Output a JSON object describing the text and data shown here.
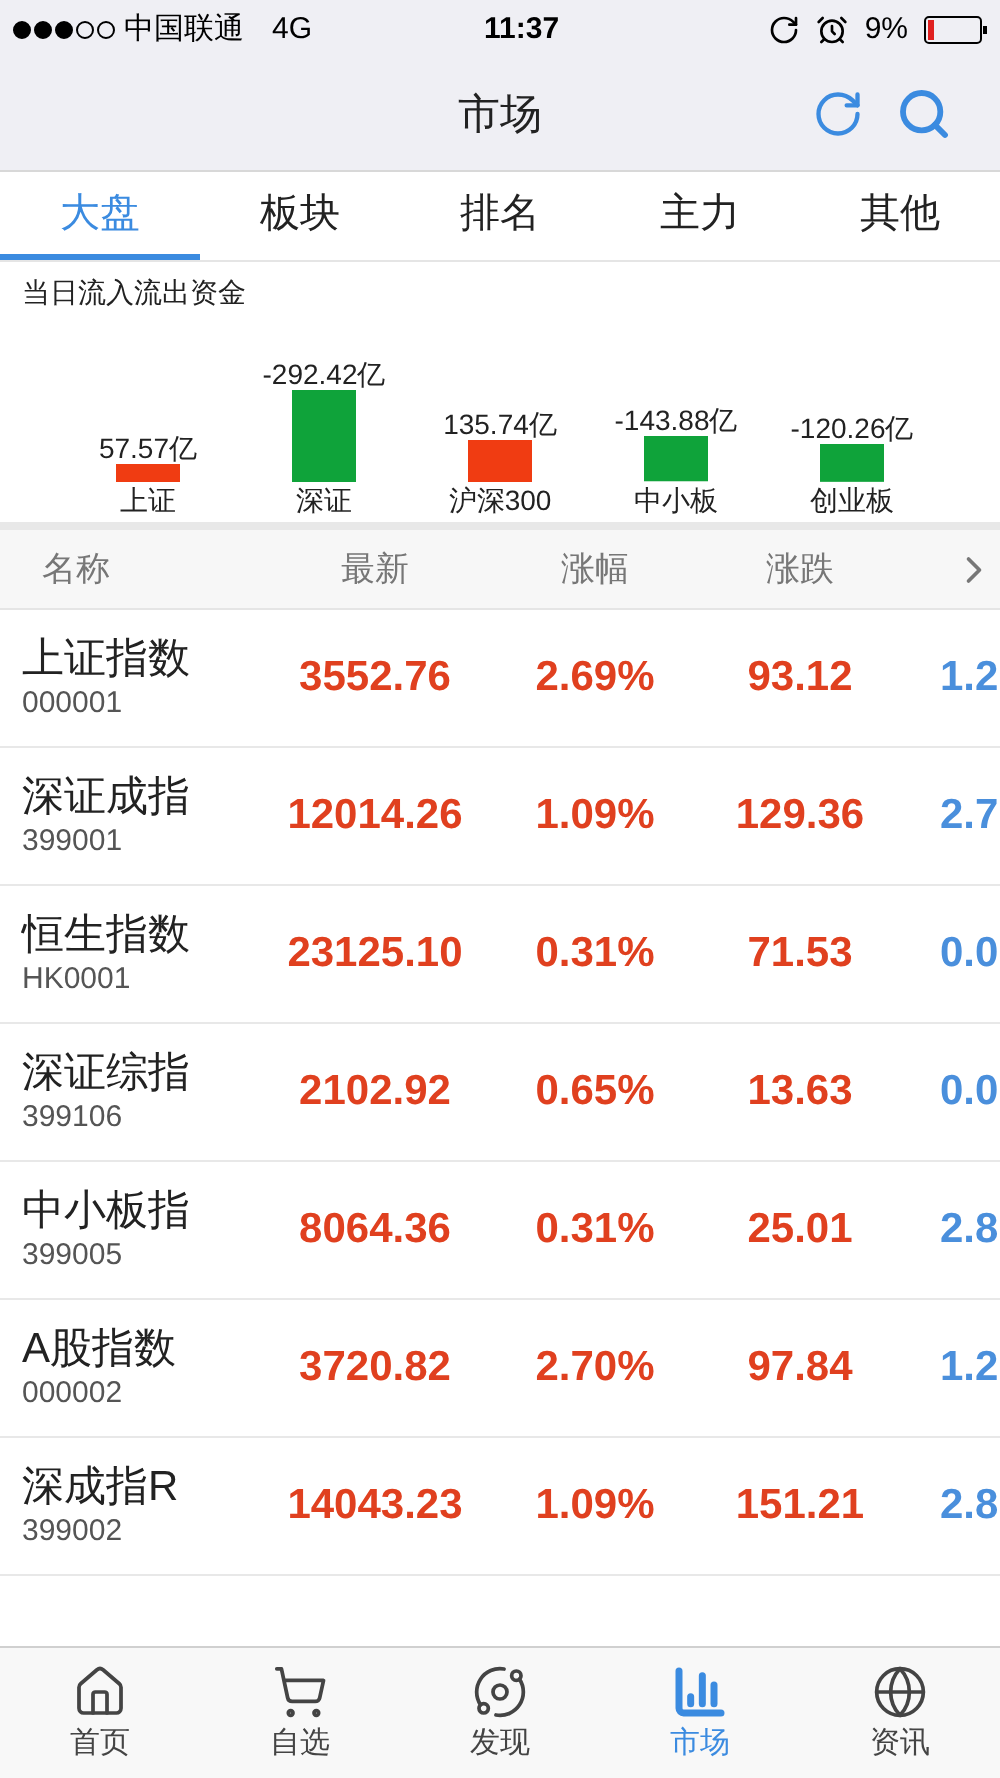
{
  "status_bar": {
    "carrier": "中国联通",
    "network": "4G",
    "time": "11:37",
    "battery": "9%"
  },
  "nav_bar": {
    "title": "市场"
  },
  "tabs": [
    {
      "label": "大盘",
      "selected": true
    },
    {
      "label": "板块",
      "selected": false
    },
    {
      "label": "排名",
      "selected": false
    },
    {
      "label": "主力",
      "selected": false
    },
    {
      "label": "其他",
      "selected": false
    }
  ],
  "fund_flow": {
    "title": "当日流入流出资金",
    "items": [
      {
        "name": "上证",
        "value": "57.57亿",
        "color": "#f03c12"
      },
      {
        "name": "深证",
        "value": "-292.42亿",
        "color": "#0fa33a"
      },
      {
        "name": "沪深300",
        "value": "135.74亿",
        "color": "#f03c12"
      },
      {
        "name": "中小板",
        "value": "-143.88亿",
        "color": "#0fa33a"
      },
      {
        "name": "创业板",
        "value": "-120.26亿",
        "color": "#0fa33a"
      }
    ]
  },
  "table": {
    "columns": [
      "名称",
      "最新",
      "涨幅",
      "涨跌"
    ],
    "rows": [
      {
        "name": "上证指数",
        "code": "000001",
        "latest": "3552.76",
        "change_pct": "2.69%",
        "change": "93.12",
        "column_5": "1.2"
      },
      {
        "name": "深证成指",
        "code": "399001",
        "latest": "12014.26",
        "change_pct": "1.09%",
        "change": "129.36",
        "column_5": "2.7"
      },
      {
        "name": "恒生指数",
        "code": "HK0001",
        "latest": "23125.10",
        "change_pct": "0.31%",
        "change": "71.53",
        "column_5": "0.0"
      },
      {
        "name": "深证综指",
        "code": "399106",
        "latest": "2102.92",
        "change_pct": "0.65%",
        "change": "13.63",
        "column_5": "0.0"
      },
      {
        "name": "中小板指",
        "code": "399005",
        "latest": "8064.36",
        "change_pct": "0.31%",
        "change": "25.01",
        "column_5": "2.8"
      },
      {
        "name": "A股指数",
        "code": "000002",
        "latest": "3720.82",
        "change_pct": "2.70%",
        "change": "97.84",
        "column_5": "1.2"
      },
      {
        "name": "深成指R",
        "code": "399002",
        "latest": "14043.23",
        "change_pct": "1.09%",
        "change": "151.21",
        "column_5": "2.8"
      }
    ]
  },
  "tab_bar": [
    {
      "kind": "home",
      "label": "首页",
      "selected": false
    },
    {
      "kind": "cart",
      "label": "自选",
      "selected": false
    },
    {
      "kind": "discover",
      "label": "发现",
      "selected": false
    },
    {
      "kind": "market",
      "label": "市场",
      "selected": true
    },
    {
      "kind": "news",
      "label": "资讯",
      "selected": false
    }
  ]
}
